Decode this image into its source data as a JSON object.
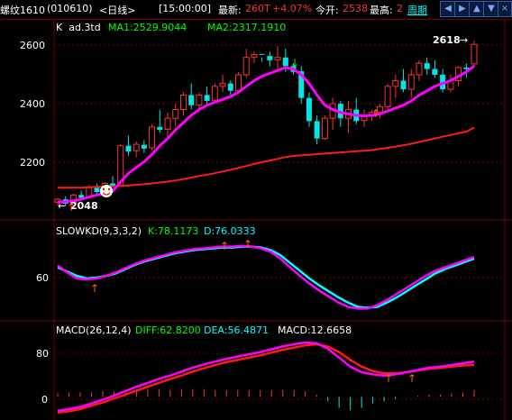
{
  "header": {
    "symbol": "螺纹1610",
    "code": "(010610)",
    "period_tab": "<日线>",
    "time": "[15:00:00]",
    "latest_label": "最新:",
    "latest_value": "260T",
    "change_pct": "+4.07%",
    "open_label": "今开:",
    "open_value": "2538",
    "high_label": "最高:",
    "high_value": "2",
    "period_link": "周期",
    "nav_icons": [
      "prev-icon",
      "next-icon",
      "zoom-in-icon",
      "zoom-out-icon",
      "close-icon"
    ]
  },
  "colors": {
    "up": "#ff3232",
    "down": "#00e5e5",
    "ma1": "#ff00ff",
    "ma2": "#ff1a1a",
    "text_green": "#00ff00",
    "text_cyan": "#00ffff",
    "grid": "#7a0000",
    "axis_text": "#ffffff"
  },
  "main_panel": {
    "indicator_label": "K  ad.3td",
    "ma1_label": "MA1:2529.9044",
    "ma2_label": "MA2:2317.1910",
    "y_ticks": [
      "2600",
      "2400",
      "2200"
    ],
    "high_marker": "2618",
    "low_marker": "2048"
  },
  "kd_panel": {
    "title": "SLOWKD(9,3,3,2)",
    "k_label": "K:78.1173",
    "d_label": "D:76.0333",
    "y_ticks": [
      "60"
    ]
  },
  "macd_panel": {
    "title": "MACD(26,12,4)",
    "diff_label": "DIFF:62.8200",
    "dea_label": "DEA:56.4871",
    "macd_label": "MACD:12.6658",
    "y_ticks": [
      "80",
      "0"
    ]
  },
  "chart_data": {
    "type": "candlestick",
    "y_range_main": [
      2030,
      2640
    ],
    "candles": [
      [
        2060,
        2075,
        2050,
        2070
      ],
      [
        2070,
        2080,
        2048,
        2055
      ],
      [
        2058,
        2090,
        2055,
        2085
      ],
      [
        2085,
        2100,
        2070,
        2075
      ],
      [
        2078,
        2120,
        2075,
        2110
      ],
      [
        2110,
        2125,
        2090,
        2095
      ],
      [
        2096,
        2130,
        2092,
        2125
      ],
      [
        2125,
        2150,
        2110,
        2115
      ],
      [
        2118,
        2260,
        2115,
        2255
      ],
      [
        2255,
        2290,
        2220,
        2235
      ],
      [
        2238,
        2270,
        2215,
        2260
      ],
      [
        2258,
        2275,
        2230,
        2245
      ],
      [
        2248,
        2330,
        2240,
        2320
      ],
      [
        2320,
        2380,
        2300,
        2310
      ],
      [
        2312,
        2370,
        2280,
        2350
      ],
      [
        2350,
        2400,
        2320,
        2380
      ],
      [
        2380,
        2440,
        2360,
        2430
      ],
      [
        2430,
        2470,
        2380,
        2395
      ],
      [
        2396,
        2440,
        2370,
        2430
      ],
      [
        2430,
        2460,
        2400,
        2410
      ],
      [
        2412,
        2470,
        2400,
        2460
      ],
      [
        2460,
        2500,
        2440,
        2470
      ],
      [
        2470,
        2480,
        2430,
        2445
      ],
      [
        2445,
        2510,
        2440,
        2500
      ],
      [
        2500,
        2590,
        2490,
        2560
      ],
      [
        2560,
        2580,
        2540,
        2570
      ],
      [
        2572,
        2560,
        2545,
        2570
      ],
      [
        2565,
        2580,
        2530,
        2550
      ],
      [
        2552,
        2600,
        2520,
        2560
      ],
      [
        2560,
        2590,
        2510,
        2530
      ],
      [
        2530,
        2540,
        2500,
        2510
      ],
      [
        2512,
        2530,
        2400,
        2420
      ],
      [
        2420,
        2440,
        2320,
        2340
      ],
      [
        2340,
        2360,
        2260,
        2280
      ],
      [
        2280,
        2360,
        2275,
        2350
      ],
      [
        2350,
        2420,
        2310,
        2400
      ],
      [
        2400,
        2410,
        2320,
        2350
      ],
      [
        2350,
        2410,
        2300,
        2380
      ],
      [
        2380,
        2420,
        2330,
        2340
      ],
      [
        2342,
        2380,
        2320,
        2360
      ],
      [
        2360,
        2380,
        2340,
        2370
      ],
      [
        2370,
        2400,
        2350,
        2390
      ],
      [
        2390,
        2470,
        2370,
        2460
      ],
      [
        2460,
        2500,
        2420,
        2480
      ],
      [
        2480,
        2520,
        2440,
        2450
      ],
      [
        2450,
        2520,
        2420,
        2500
      ],
      [
        2500,
        2550,
        2480,
        2540
      ],
      [
        2540,
        2560,
        2500,
        2520
      ],
      [
        2520,
        2550,
        2490,
        2500
      ],
      [
        2500,
        2520,
        2440,
        2450
      ],
      [
        2450,
        2500,
        2440,
        2480
      ],
      [
        2480,
        2530,
        2460,
        2525
      ],
      [
        2525,
        2540,
        2490,
        2520
      ],
      [
        2538,
        2618,
        2530,
        2605
      ]
    ],
    "ma1": [
      2060,
      2062,
      2065,
      2070,
      2078,
      2085,
      2092,
      2098,
      2130,
      2160,
      2180,
      2200,
      2225,
      2255,
      2280,
      2310,
      2335,
      2360,
      2380,
      2395,
      2405,
      2415,
      2425,
      2440,
      2460,
      2480,
      2495,
      2505,
      2515,
      2525,
      2520,
      2500,
      2470,
      2430,
      2395,
      2380,
      2370,
      2365,
      2360,
      2358,
      2360,
      2365,
      2375,
      2385,
      2395,
      2410,
      2430,
      2445,
      2460,
      2470,
      2480,
      2495,
      2510,
      2530
    ],
    "ma2": [
      2110,
      2110,
      2110,
      2110,
      2112,
      2113,
      2114,
      2115,
      2116,
      2118,
      2120,
      2122,
      2125,
      2128,
      2131,
      2135,
      2140,
      2145,
      2150,
      2155,
      2160,
      2166,
      2172,
      2178,
      2185,
      2192,
      2198,
      2204,
      2210,
      2216,
      2220,
      2222,
      2224,
      2226,
      2228,
      2230,
      2232,
      2234,
      2236,
      2238,
      2240,
      2244,
      2248,
      2252,
      2257,
      2262,
      2268,
      2274,
      2280,
      2286,
      2292,
      2298,
      2304,
      2318
    ],
    "kd_k": [
      70,
      62,
      55,
      54,
      55,
      58,
      62,
      67,
      72,
      76,
      79,
      82,
      85,
      87,
      89,
      90,
      91,
      92,
      92,
      93,
      92,
      90,
      86,
      78,
      68,
      58,
      49,
      41,
      34,
      27,
      22,
      20,
      20,
      24,
      30,
      37,
      44,
      51,
      58,
      64,
      68,
      72,
      76,
      80
    ],
    "kd_d": [
      68,
      63,
      58,
      55,
      56,
      58,
      61,
      66,
      71,
      75,
      78,
      81,
      84,
      86,
      88,
      89,
      90,
      91,
      91,
      92,
      92,
      91,
      88,
      82,
      73,
      64,
      55,
      47,
      40,
      33,
      27,
      22,
      21,
      22,
      27,
      33,
      40,
      47,
      54,
      61,
      66,
      70,
      74,
      78
    ],
    "macd_diff": [
      -25,
      -22,
      -18,
      -12,
      -5,
      2,
      10,
      18,
      25,
      32,
      38,
      45,
      52,
      58,
      63,
      68,
      72,
      76,
      80,
      85,
      90,
      94,
      97,
      96,
      86,
      70,
      54,
      44,
      40,
      38,
      40,
      44,
      48,
      52,
      54,
      57,
      60,
      63
    ],
    "macd_dea": [
      -28,
      -26,
      -22,
      -16,
      -10,
      -3,
      4,
      11,
      18,
      25,
      32,
      38,
      45,
      51,
      57,
      62,
      66,
      70,
      74,
      79,
      84,
      88,
      92,
      94,
      90,
      80,
      66,
      54,
      46,
      42,
      42,
      44,
      47,
      50,
      52,
      54,
      56,
      57
    ]
  }
}
